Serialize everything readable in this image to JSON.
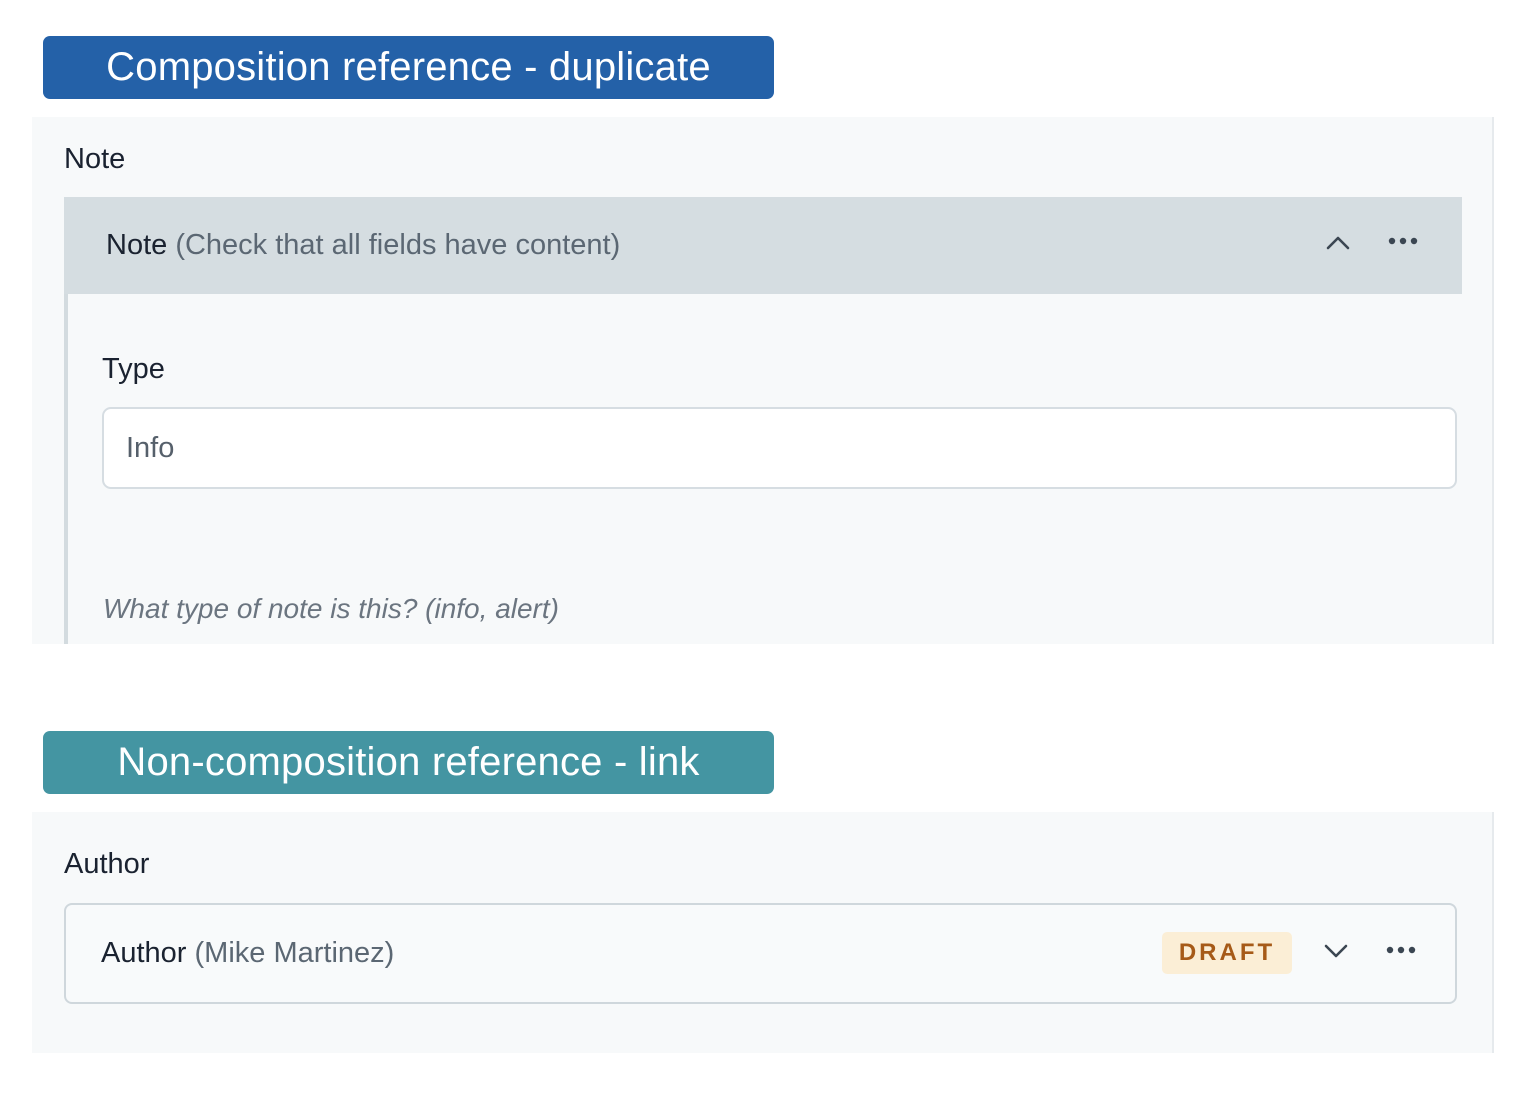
{
  "sections": {
    "composition": {
      "tag_label": "Composition reference - duplicate",
      "tag_color": "#2461a8",
      "field_title": "Note",
      "entry": {
        "title": "Note",
        "subtitle": "(Check that all fields have content)",
        "collapse_icon": "chevron-up-icon",
        "menu_icon": "more-horizontal-icon"
      },
      "type_field": {
        "label": "Type",
        "value": "Info",
        "help_text": "What type of note is this? (info, alert)"
      }
    },
    "non_composition": {
      "tag_label": "Non-composition reference - link",
      "tag_color": "#4495a2",
      "field_title": "Author",
      "link": {
        "title": "Author",
        "subtitle": "(Mike Martinez)",
        "status_badge": "DRAFT",
        "expand_icon": "chevron-down-icon",
        "menu_icon": "more-horizontal-icon"
      }
    }
  }
}
